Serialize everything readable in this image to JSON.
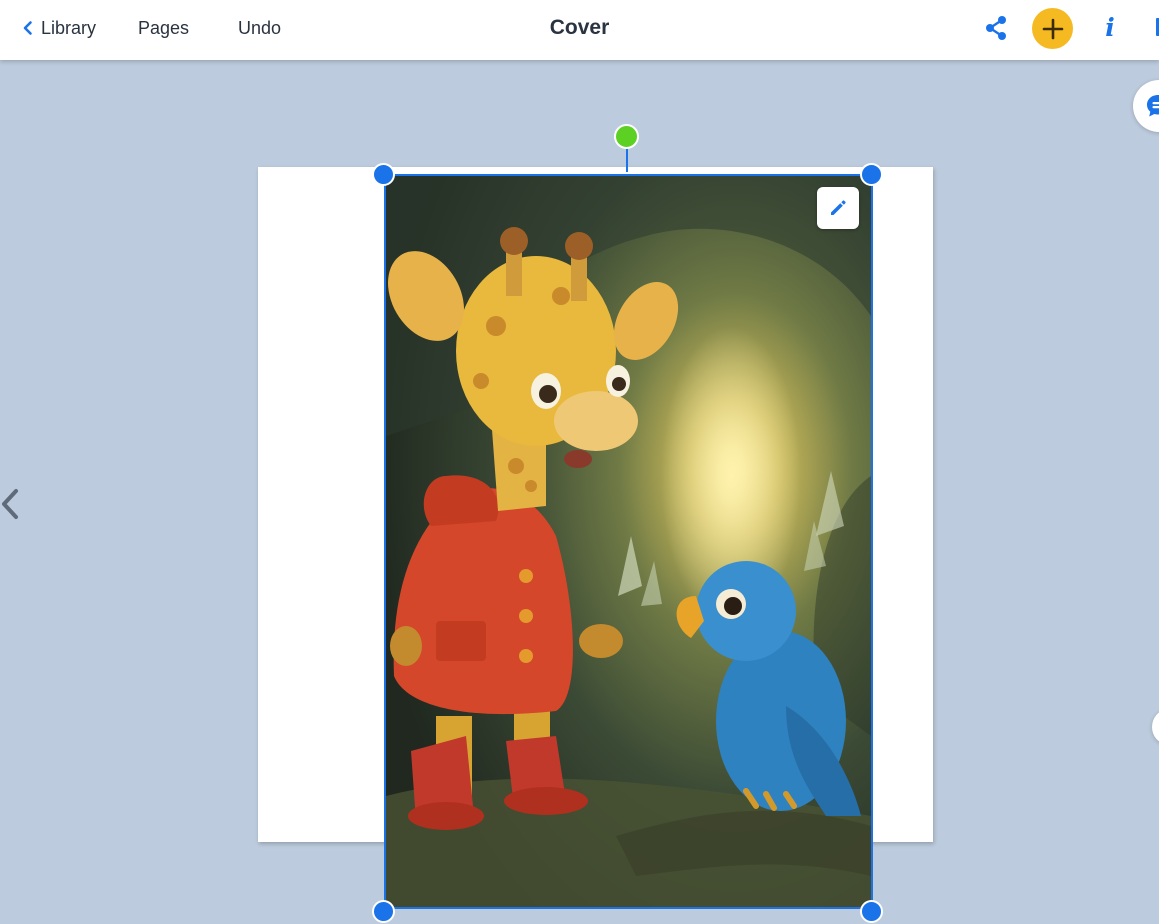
{
  "topbar": {
    "back_label": "Library",
    "pages_label": "Pages",
    "undo_label": "Undo",
    "title": "Cover",
    "info_label": "i"
  },
  "colors": {
    "accent": "#1a73e8",
    "add_button": "#f5b921",
    "rotate_handle": "#5dd024",
    "canvas_background": "#bccbdd"
  },
  "icons": {
    "back": "chevron-left-icon",
    "share": "share-icon",
    "add": "plus-icon",
    "info": "info-icon",
    "prev_page": "chevron-left-icon",
    "chat": "chat-bubble-icon",
    "edit": "pencil-icon"
  },
  "image": {
    "selected": true
  }
}
